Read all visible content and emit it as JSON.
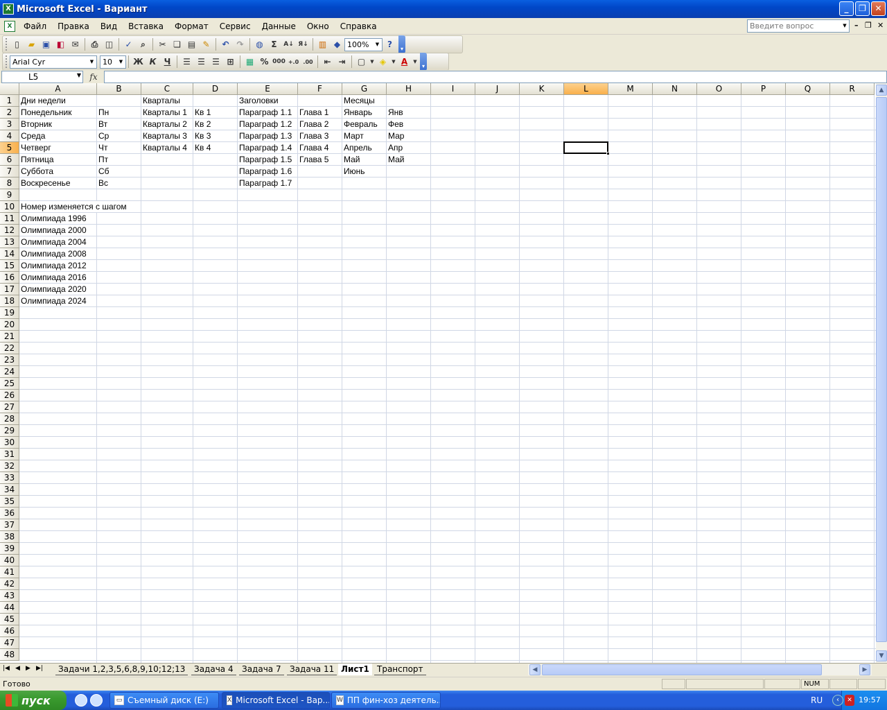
{
  "window": {
    "title": "Microsoft Excel - Вариант",
    "app_icon": "excel-icon",
    "buttons": [
      "_",
      "❐",
      "✕"
    ]
  },
  "menu": {
    "items": [
      "Файл",
      "Правка",
      "Вид",
      "Вставка",
      "Формат",
      "Сервис",
      "Данные",
      "Окно",
      "Справка"
    ],
    "help_placeholder": "Введите вопрос"
  },
  "standard_toolbar": {
    "zoom": "100%",
    "buttons": [
      "new-icon",
      "open-icon",
      "save-icon",
      "permission-icon",
      "email-icon",
      "print-icon",
      "print-preview-icon",
      "spelling-icon",
      "research-icon",
      "cut-icon",
      "copy-icon",
      "paste-icon",
      "format-painter-icon",
      "undo-icon",
      "redo-icon",
      "hyperlink-icon",
      "autosum-icon",
      "sort-ascending-icon",
      "sort-descending-icon",
      "chart-wizard-icon",
      "drawing-icon"
    ]
  },
  "formatting_toolbar": {
    "font": "Arial Cyr",
    "size": "10",
    "bold": "Ж",
    "italic": "К",
    "underline": "Ч",
    "percent": "%",
    "thousands": "000"
  },
  "formula_bar": {
    "name_box": "L5",
    "fx": "fx",
    "content": ""
  },
  "columns": [
    "A",
    "B",
    "C",
    "D",
    "E",
    "F",
    "G",
    "H",
    "I",
    "J",
    "K",
    "L",
    "M",
    "N",
    "O",
    "P",
    "Q",
    "R"
  ],
  "selected_column": "L",
  "selected_row": 5,
  "row_count": 48,
  "cells": [
    {
      "ref": "A1",
      "text": "Дни недели"
    },
    {
      "ref": "C1",
      "text": "Кварталы"
    },
    {
      "ref": "E1",
      "text": "Заголовки"
    },
    {
      "ref": "G1",
      "text": "Месяцы"
    },
    {
      "ref": "A2",
      "text": "Понедельник"
    },
    {
      "ref": "B2",
      "text": "Пн"
    },
    {
      "ref": "C2",
      "text": "Кварталы 1"
    },
    {
      "ref": "D2",
      "text": "Кв 1"
    },
    {
      "ref": "E2",
      "text": "Параграф 1.1"
    },
    {
      "ref": "F2",
      "text": "Глава 1"
    },
    {
      "ref": "G2",
      "text": "Январь"
    },
    {
      "ref": "H2",
      "text": "Янв"
    },
    {
      "ref": "A3",
      "text": "Вторник"
    },
    {
      "ref": "B3",
      "text": "Вт"
    },
    {
      "ref": "C3",
      "text": "Кварталы 2"
    },
    {
      "ref": "D3",
      "text": "Кв 2"
    },
    {
      "ref": "E3",
      "text": "Параграф 1.2"
    },
    {
      "ref": "F3",
      "text": "Глава 2"
    },
    {
      "ref": "G3",
      "text": "Февраль"
    },
    {
      "ref": "H3",
      "text": "Фев"
    },
    {
      "ref": "A4",
      "text": "Среда"
    },
    {
      "ref": "B4",
      "text": "Ср"
    },
    {
      "ref": "C4",
      "text": "Кварталы 3"
    },
    {
      "ref": "D4",
      "text": "Кв 3"
    },
    {
      "ref": "E4",
      "text": "Параграф 1.3"
    },
    {
      "ref": "F4",
      "text": "Глава 3"
    },
    {
      "ref": "G4",
      "text": "Март"
    },
    {
      "ref": "H4",
      "text": "Мар"
    },
    {
      "ref": "A5",
      "text": "Четверг"
    },
    {
      "ref": "B5",
      "text": "Чт"
    },
    {
      "ref": "C5",
      "text": "Кварталы 4"
    },
    {
      "ref": "D5",
      "text": "Кв 4"
    },
    {
      "ref": "E5",
      "text": "Параграф 1.4"
    },
    {
      "ref": "F5",
      "text": "Глава 4"
    },
    {
      "ref": "G5",
      "text": "Апрель"
    },
    {
      "ref": "H5",
      "text": "Апр"
    },
    {
      "ref": "A6",
      "text": "Пятница"
    },
    {
      "ref": "B6",
      "text": "Пт"
    },
    {
      "ref": "E6",
      "text": "Параграф 1.5"
    },
    {
      "ref": "F6",
      "text": "Глава 5"
    },
    {
      "ref": "G6",
      "text": "Май"
    },
    {
      "ref": "H6",
      "text": "Май"
    },
    {
      "ref": "A7",
      "text": "Суббота"
    },
    {
      "ref": "B7",
      "text": "Сб"
    },
    {
      "ref": "E7",
      "text": "Параграф 1.6"
    },
    {
      "ref": "G7",
      "text": "Июнь"
    },
    {
      "ref": "A8",
      "text": "Воскресенье"
    },
    {
      "ref": "B8",
      "text": "Вс"
    },
    {
      "ref": "E8",
      "text": "Параграф 1.7"
    },
    {
      "ref": "A10",
      "text": "Номер изменяется с шагом"
    },
    {
      "ref": "A11",
      "text": "Олимпиада 1996"
    },
    {
      "ref": "A12",
      "text": "Олимпиада 2000"
    },
    {
      "ref": "A13",
      "text": "Олимпиада 2004"
    },
    {
      "ref": "A14",
      "text": "Олимпиада 2008"
    },
    {
      "ref": "A15",
      "text": "Олимпиада 2012"
    },
    {
      "ref": "A16",
      "text": "Олимпиада 2016"
    },
    {
      "ref": "A17",
      "text": "Олимпиада 2020"
    },
    {
      "ref": "A18",
      "text": "Олимпиада 2024"
    }
  ],
  "sheet_tabs": [
    {
      "name": "Задачи 1,2,3,5,6,8,9,10;12;13",
      "active": false
    },
    {
      "name": "Задача 4",
      "active": false
    },
    {
      "name": "Задача 7",
      "active": false
    },
    {
      "name": "Задача 11",
      "active": false
    },
    {
      "name": "Лист1",
      "active": true
    },
    {
      "name": "Транспорт",
      "active": false
    }
  ],
  "status": {
    "text": "Готово",
    "num": "NUM"
  },
  "taskbar": {
    "start": "пуск",
    "tasks": [
      {
        "label": "Съемный диск (E:)",
        "icon": "drive-icon",
        "active": false
      },
      {
        "label": "Microsoft Excel - Вар...",
        "icon": "excel-icon",
        "active": true
      },
      {
        "label": "ПП фин-хоз деятель...",
        "icon": "word-icon",
        "active": false
      }
    ],
    "lang": "RU",
    "clock": "19:57"
  }
}
